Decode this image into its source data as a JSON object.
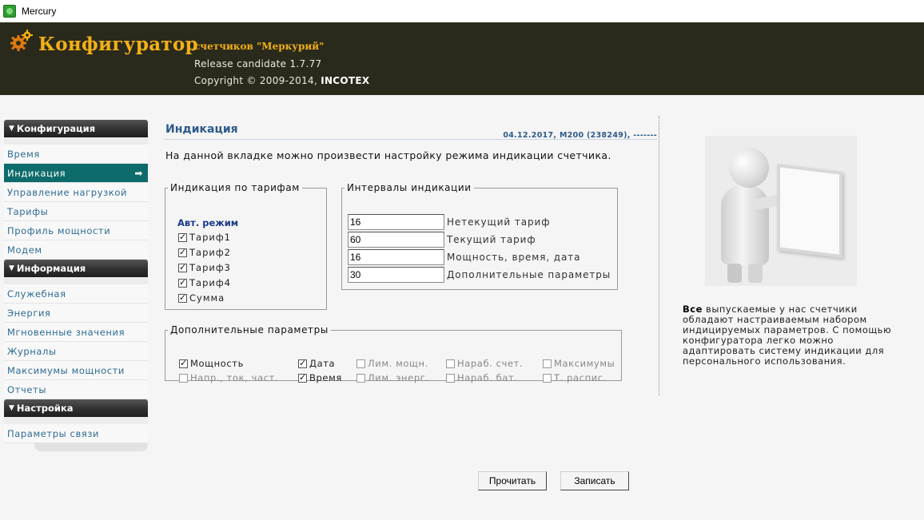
{
  "window": {
    "title": "Mercury"
  },
  "banner": {
    "brand": "Конфигуратор",
    "subtitle": "счетчиков \"Меркурий\"",
    "release": "Release candidate 1.7.77",
    "copyright_prefix": "Copyright © 2009-2014, ",
    "copyright_company": "INCOTEX",
    "brand_color": "#f2b017",
    "background_color": "#2a2a1c"
  },
  "sidebar": {
    "groups": [
      {
        "title": "Конфигурация",
        "items": [
          "Время",
          "Индикация",
          "Управление нагрузкой",
          "Тарифы",
          "Профиль мощности",
          "Модем"
        ]
      },
      {
        "title": "Информация",
        "items": [
          "Служебная",
          "Энергия",
          "Мгновенные значения",
          "Журналы",
          "Максимумы мощности",
          "Отчеты"
        ]
      },
      {
        "title": "Настройка",
        "items": [
          "Параметры связи"
        ]
      }
    ],
    "active_item": "Индикация",
    "active_color": "#0d6b6b"
  },
  "main": {
    "title": "Индикация",
    "meta": "04.12.2017, М200 (238249), -------",
    "intro": "На данной вкладке можно произвести настройку режима индикации счетчика.",
    "tariffs": {
      "legend": "Индикация по тарифам",
      "mode_label": "Авт. режим",
      "items": [
        {
          "label": "Тариф1",
          "checked": true
        },
        {
          "label": "Тариф2",
          "checked": true
        },
        {
          "label": "Тариф3",
          "checked": true
        },
        {
          "label": "Тариф4",
          "checked": true
        },
        {
          "label": "Сумма",
          "checked": true
        }
      ]
    },
    "intervals": {
      "legend": "Интервалы индикации",
      "rows": [
        {
          "value": "16",
          "label": "Нетекущий тариф"
        },
        {
          "value": "60",
          "label": "Текущий тариф"
        },
        {
          "value": "16",
          "label": "Мощность, время, дата"
        },
        {
          "value": "30",
          "label": "Дополнительные параметры"
        }
      ]
    },
    "extra": {
      "legend": "Дополнительные параметры",
      "row1": [
        {
          "label": "Мощность",
          "checked": true,
          "enabled": true
        },
        {
          "label": "Дата",
          "checked": true,
          "enabled": true
        },
        {
          "label": "Лим. мощн.",
          "checked": false,
          "enabled": false
        },
        {
          "label": "Нараб. счет.",
          "checked": false,
          "enabled": false
        },
        {
          "label": "Максимумы",
          "checked": false,
          "enabled": false
        }
      ],
      "row2": [
        {
          "label": "Напр., ток, част.",
          "checked": false,
          "enabled": false
        },
        {
          "label": "Время",
          "checked": true,
          "enabled": true
        },
        {
          "label": "Лим. энерг.",
          "checked": false,
          "enabled": false
        },
        {
          "label": "Нараб. бат.",
          "checked": false,
          "enabled": false
        },
        {
          "label": "Т. распис.",
          "checked": false,
          "enabled": false
        }
      ]
    }
  },
  "promo": {
    "bold": "Все",
    "text": " выпускаемые у нас счетчики обладают настраиваемым набором индицируемых параметров. С помощью конфигуратора легко можно адаптировать систему индикации для персонального использования."
  },
  "buttons": {
    "read": "Прочитать",
    "write": "Записать"
  }
}
